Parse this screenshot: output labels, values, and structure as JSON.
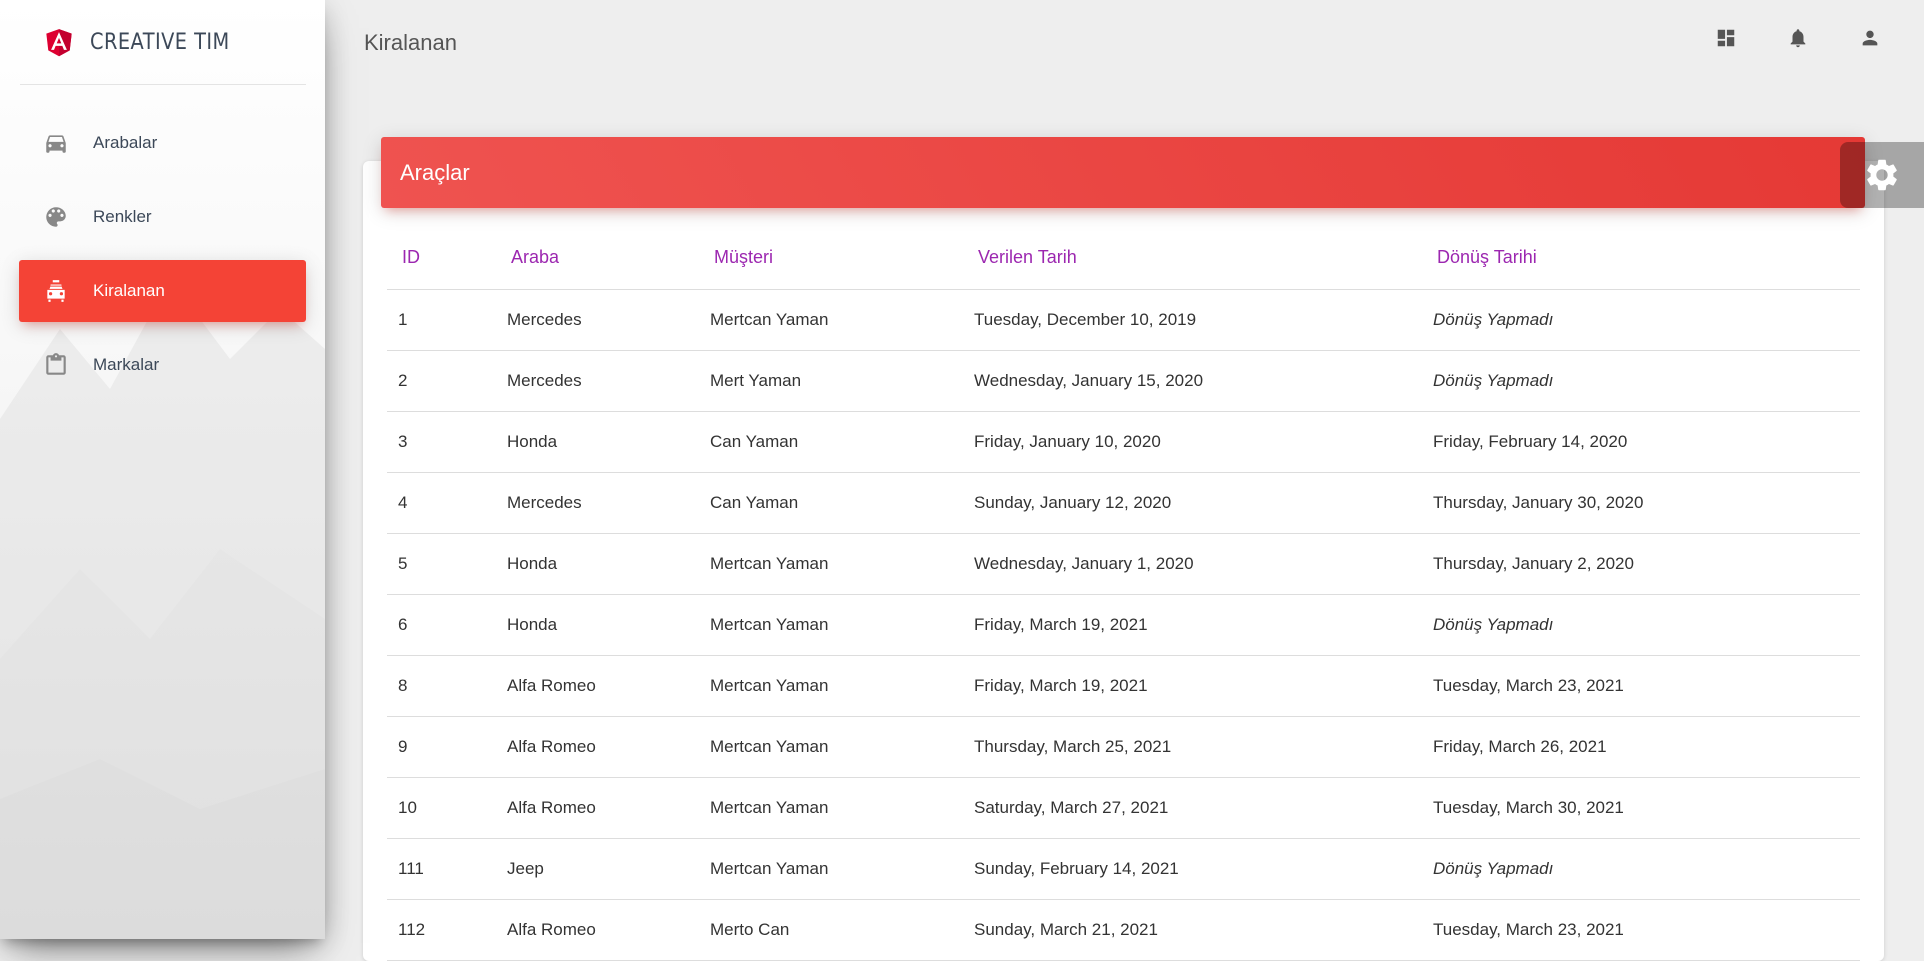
{
  "brand": {
    "name": "CREATIVE TIM",
    "logo_icon": "angular-logo-icon"
  },
  "sidebar": {
    "items": [
      {
        "label": "Arabalar",
        "icon": "car-icon",
        "active": false
      },
      {
        "label": "Renkler",
        "icon": "palette-icon",
        "active": false
      },
      {
        "label": "Kiralanan",
        "icon": "car-rental-icon",
        "active": true
      },
      {
        "label": "Markalar",
        "icon": "clipboard-icon",
        "active": false
      }
    ]
  },
  "header": {
    "title": "Kiralanan",
    "actions": [
      {
        "icon": "dashboard-icon"
      },
      {
        "icon": "notifications-icon"
      },
      {
        "icon": "person-icon"
      }
    ]
  },
  "card": {
    "title": "Araçlar"
  },
  "colors": {
    "accent": "#f44336",
    "header_text": "#9c27b0"
  },
  "table": {
    "columns": [
      "ID",
      "Araba",
      "Müşteri",
      "Verilen Tarih",
      "Dönüş Tarihi"
    ],
    "rows": [
      [
        "1",
        "Mercedes",
        "Mertcan Yaman",
        "Tuesday, December 10, 2019",
        "Dönüş Yapmadı"
      ],
      [
        "2",
        "Mercedes",
        "Mert Yaman",
        "Wednesday, January 15, 2020",
        "Dönüş Yapmadı"
      ],
      [
        "3",
        "Honda",
        "Can Yaman",
        "Friday, January 10, 2020",
        "Friday, February 14, 2020"
      ],
      [
        "4",
        "Mercedes",
        "Can Yaman",
        "Sunday, January 12, 2020",
        "Thursday, January 30, 2020"
      ],
      [
        "5",
        "Honda",
        "Mertcan Yaman",
        "Wednesday, January 1, 2020",
        "Thursday, January 2, 2020"
      ],
      [
        "6",
        "Honda",
        "Mertcan Yaman",
        "Friday, March 19, 2021",
        "Dönüş Yapmadı"
      ],
      [
        "8",
        "Alfa Romeo",
        "Mertcan Yaman",
        "Friday, March 19, 2021",
        "Tuesday, March 23, 2021"
      ],
      [
        "9",
        "Alfa Romeo",
        "Mertcan Yaman",
        "Thursday, March 25, 2021",
        "Friday, March 26, 2021"
      ],
      [
        "10",
        "Alfa Romeo",
        "Mertcan Yaman",
        "Saturday, March 27, 2021",
        "Tuesday, March 30, 2021"
      ],
      [
        "111",
        "Jeep",
        "Mertcan Yaman",
        "Sunday, February 14, 2021",
        "Dönüş Yapmadı"
      ],
      [
        "112",
        "Alfa Romeo",
        "Merto Can",
        "Sunday, March 21, 2021",
        "Tuesday, March 23, 2021"
      ]
    ]
  }
}
